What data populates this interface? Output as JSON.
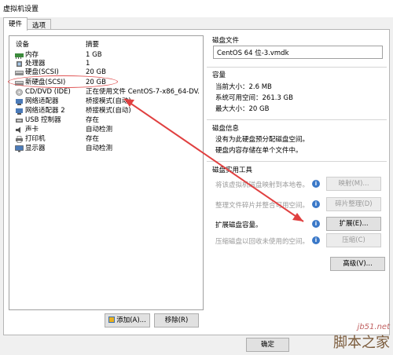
{
  "window": {
    "title": "虚拟机设置"
  },
  "tabs": [
    {
      "label": "硬件",
      "active": true
    },
    {
      "label": "选项",
      "active": false
    }
  ],
  "device_list": {
    "headers": {
      "device": "设备",
      "summary": "摘要"
    },
    "rows": [
      {
        "icon": "memory-icon",
        "name": "内存",
        "summary": "1 GB"
      },
      {
        "icon": "processor-icon",
        "name": "处理器",
        "summary": "1"
      },
      {
        "icon": "hard-disk-icon",
        "name": "硬盘(SCSI)",
        "summary": "20 GB"
      },
      {
        "icon": "hard-disk-icon",
        "name": "新硬盘(SCSI)",
        "summary": "20 GB",
        "selected": true
      },
      {
        "icon": "cd-dvd-icon",
        "name": "CD/DVD (IDE)",
        "summary": "正在使用文件 CentOS-7-x86_64-DV..."
      },
      {
        "icon": "network-adapter-icon",
        "name": "网络适配器",
        "summary": "桥接模式(自动)"
      },
      {
        "icon": "network-adapter-icon",
        "name": "网络适配器 2",
        "summary": "桥接模式(自动)"
      },
      {
        "icon": "usb-controller-icon",
        "name": "USB 控制器",
        "summary": "存在"
      },
      {
        "icon": "sound-card-icon",
        "name": "声卡",
        "summary": "自动检测"
      },
      {
        "icon": "printer-icon",
        "name": "打印机",
        "summary": "存在"
      },
      {
        "icon": "display-icon",
        "name": "显示器",
        "summary": "自动检测"
      }
    ],
    "add_button": "添加(A)...",
    "remove_button": "移除(R)"
  },
  "disk_file": {
    "label": "磁盘文件",
    "value": "CentOS 64 位-3.vmdk"
  },
  "capacity": {
    "label": "容量",
    "current": "当前大小：2.6 MB",
    "free": "系统可用空间：261.3 GB",
    "max": "最大大小：20 GB"
  },
  "disk_info": {
    "label": "磁盘信息",
    "line1": "没有为此硬盘预分配磁盘空间。",
    "line2": "硬盘内容存储在单个文件中。"
  },
  "disk_utilities": {
    "label": "磁盘实用工具",
    "items": [
      {
        "text": "将该虚拟机磁盘映射到本地卷。",
        "button": "映射(M)...",
        "enabled": false
      },
      {
        "text": "整理文件碎片并整合可用空间。",
        "button": "碎片整理(D)",
        "enabled": false
      },
      {
        "text": "扩展磁盘容量。",
        "button": "扩展(E)...",
        "enabled": true
      },
      {
        "text": "压缩磁盘以回收未使用的空间。",
        "button": "压缩(C)",
        "enabled": false
      }
    ]
  },
  "advanced_button": "高级(V)...",
  "ok_button": "确定",
  "watermark": {
    "site": "jb51.net",
    "brand": "脚本之家"
  }
}
